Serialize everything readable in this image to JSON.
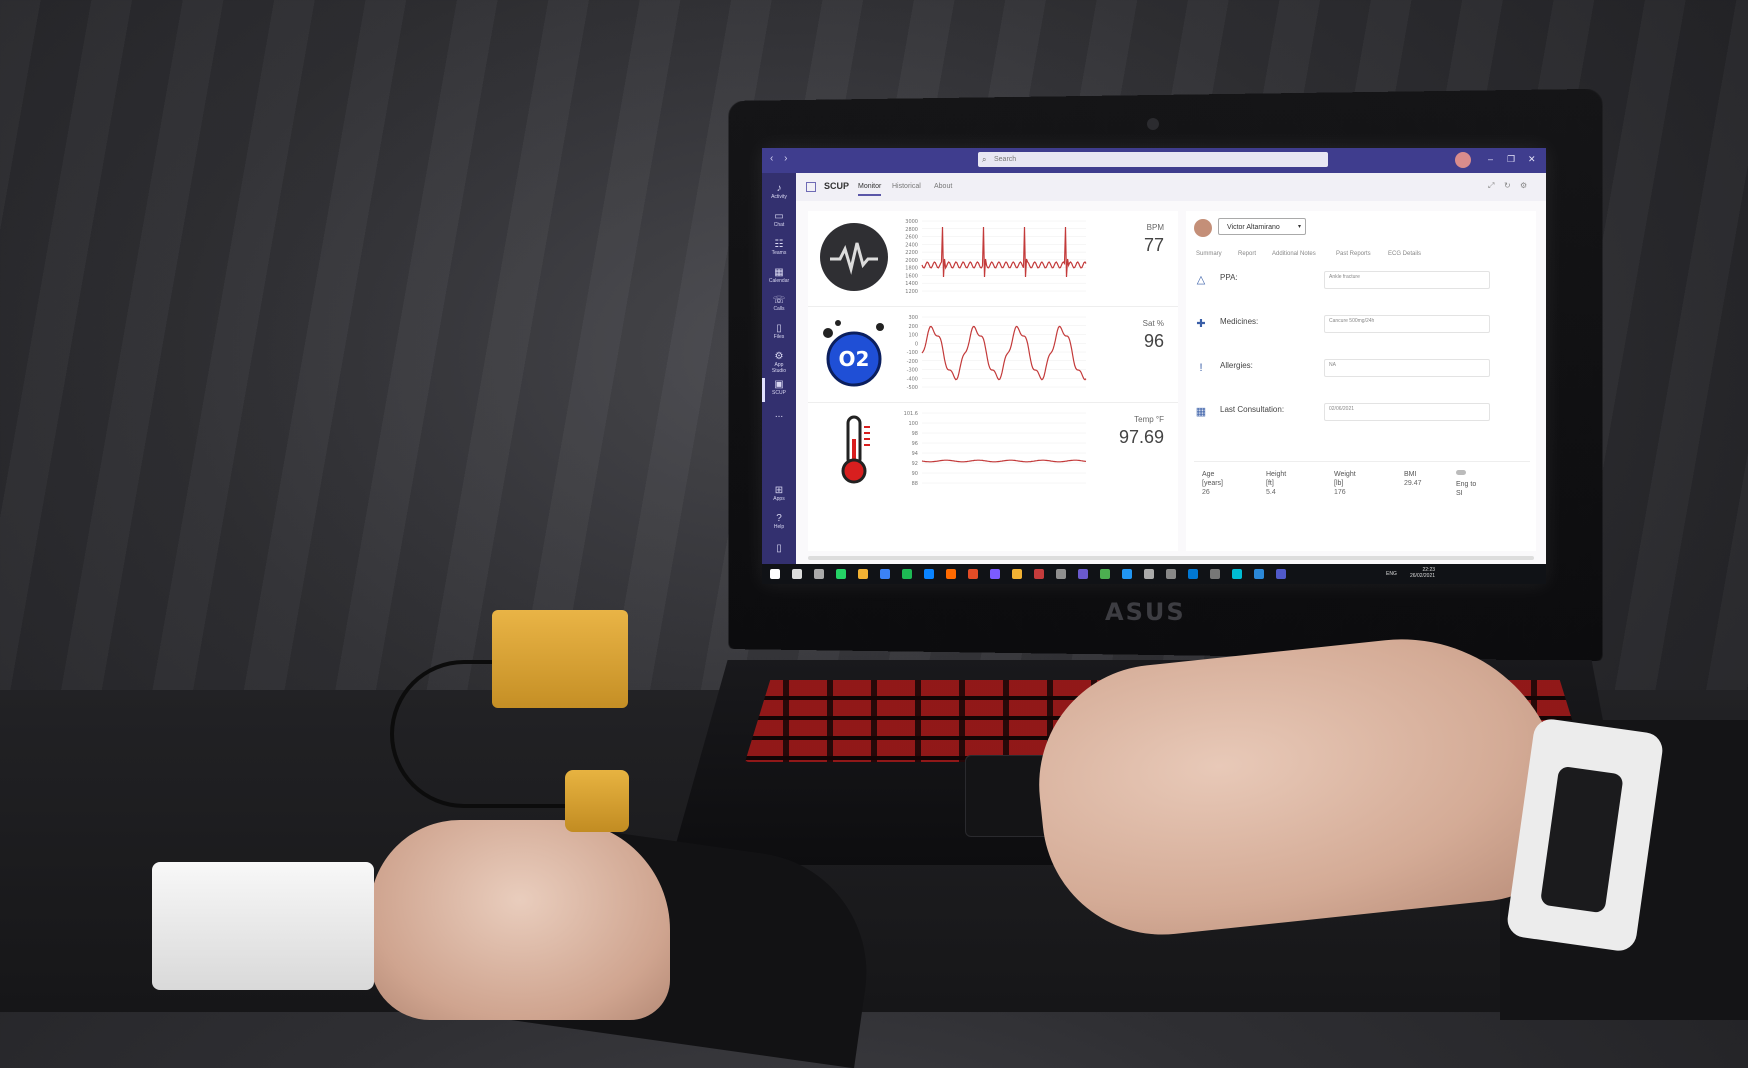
{
  "laptop": {
    "brand": "ASUS"
  },
  "teams": {
    "search_placeholder": "Search",
    "window_controls": [
      "–",
      "❐",
      "✕"
    ],
    "rail": [
      {
        "label": "Activity",
        "icon": "bell-icon"
      },
      {
        "label": "Chat",
        "icon": "chat-icon"
      },
      {
        "label": "Teams",
        "icon": "teams-icon"
      },
      {
        "label": "Calendar",
        "icon": "calendar-icon"
      },
      {
        "label": "Calls",
        "icon": "phone-icon"
      },
      {
        "label": "Files",
        "icon": "file-icon"
      },
      {
        "label": "App Studio",
        "icon": "app-studio-icon"
      },
      {
        "label": "SCUP",
        "icon": "scup-icon"
      },
      {
        "label": "...",
        "icon": "more-icon"
      },
      {
        "label": "Apps",
        "icon": "apps-icon"
      },
      {
        "label": "Help",
        "icon": "help-icon"
      }
    ]
  },
  "app": {
    "name": "SCUP",
    "tabs": [
      "Monitor",
      "Historical",
      "About"
    ],
    "active_tab": "Monitor"
  },
  "vitals": {
    "bpm": {
      "label": "BPM",
      "value": "77",
      "y_ticks": [
        "3000",
        "2800",
        "2600",
        "2400",
        "2200",
        "2000",
        "1800",
        "1600",
        "1400",
        "1200"
      ]
    },
    "sat": {
      "label": "Sat %",
      "value": "96",
      "y_ticks": [
        "300",
        "200",
        "100",
        "0",
        "-100",
        "-200",
        "-300",
        "-400",
        "-500"
      ],
      "o2_label": "O2"
    },
    "temp": {
      "label": "Temp °F",
      "value": "97.69",
      "y_ticks": [
        "101.6",
        "100",
        "98",
        "96",
        "94",
        "92",
        "90",
        "88"
      ]
    }
  },
  "patient": {
    "name": "Victor Altamirano",
    "tabs": [
      "Summary",
      "Report",
      "Additional Notes",
      "Past Reports",
      "ECG Details"
    ],
    "fields": [
      {
        "label": "PPA:",
        "value": "Ankle fracture",
        "icon": "warning-triangle-icon"
      },
      {
        "label": "Medicines:",
        "value": "Cancure 500mg/24h",
        "icon": "medical-cross-icon"
      },
      {
        "label": "Allergies:",
        "value": "NA",
        "icon": "alert-icon"
      },
      {
        "label": "Last Consultation:",
        "value": "02/06/2021",
        "icon": "calendar-icon"
      }
    ],
    "stats": {
      "age_label": "Age\n[years]",
      "age": "26",
      "height_label": "Height\n[ft]",
      "height": "5.4",
      "weight_label": "Weight\n[lb]",
      "weight": "176",
      "bmi_label": "BMI",
      "bmi": "29.47",
      "toggle_label": "Eng to\nSI"
    }
  },
  "taskbar": {
    "lang": "ENG",
    "time": "22:23",
    "date": "26/02/2021"
  },
  "colors": {
    "titlebar": "#3f3d8e",
    "rail": "#33306f",
    "trace": "#c33a3a",
    "o2_blue": "#1f4fd6",
    "thermo_red": "#d81f1f"
  }
}
